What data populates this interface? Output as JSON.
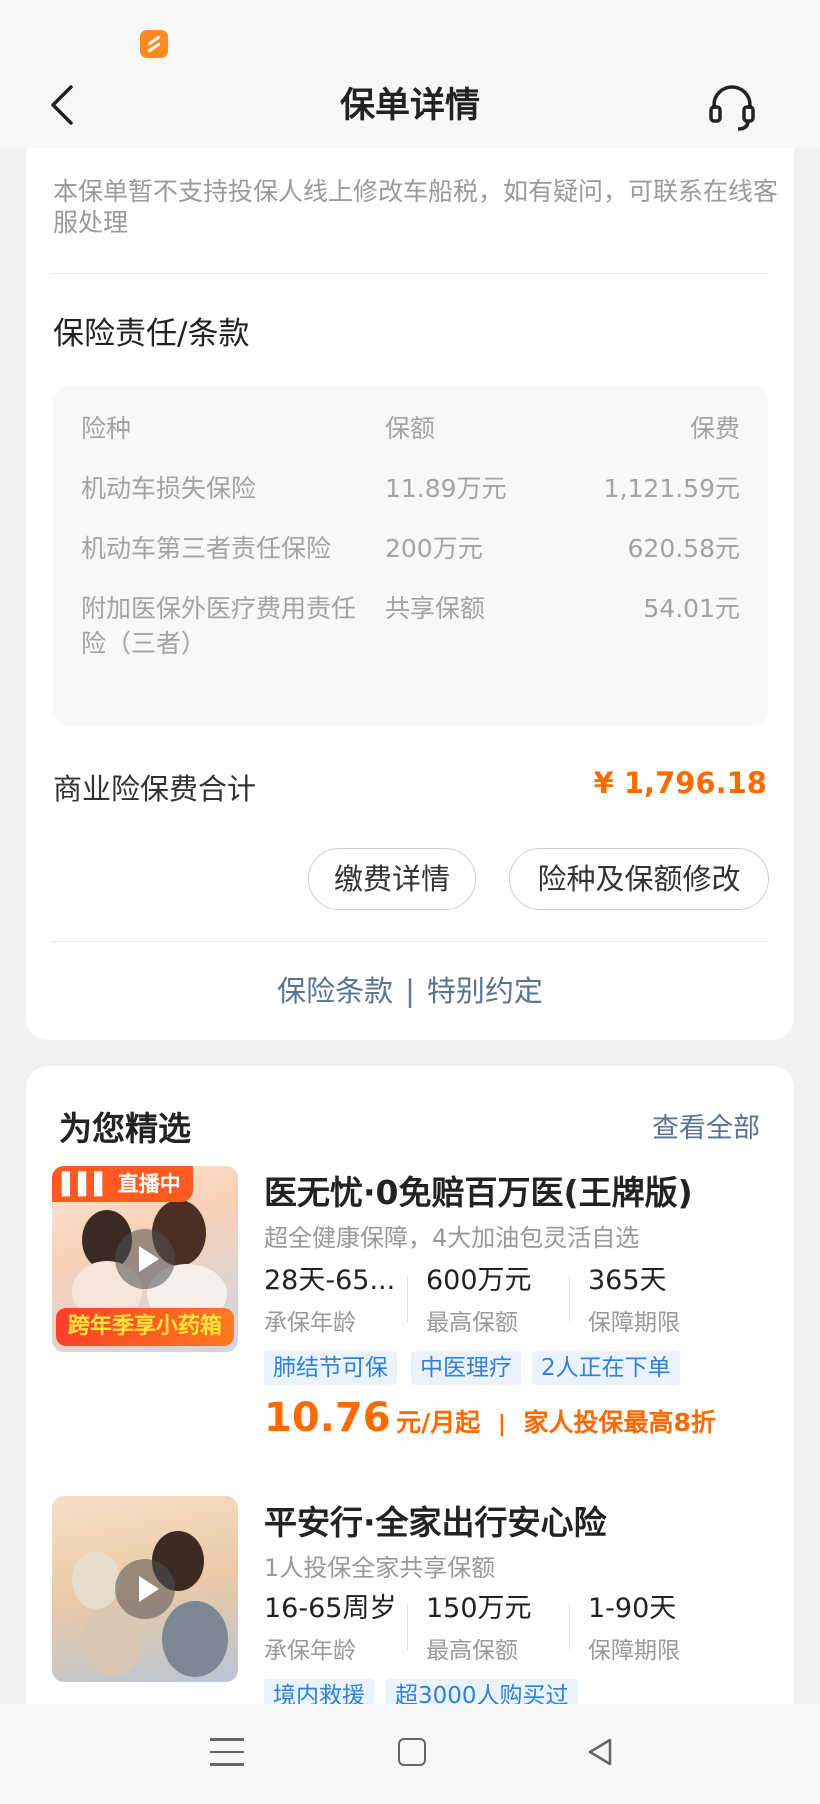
{
  "nav": {
    "title": "保单详情"
  },
  "policy": {
    "notice": "本保单暂不支持投保人线上修改车船税，如有疑问，可联系在线客服处理",
    "section_title": "保险责任/条款",
    "table_headers": [
      "险种",
      "保额",
      "保费"
    ],
    "coverages": [
      {
        "name": "机动车损失保险",
        "amount": "11.89万元",
        "premium": "1,121.59元"
      },
      {
        "name": "机动车第三者责任保险",
        "amount": "200万元",
        "premium": "620.58元"
      },
      {
        "name": "附加医保外医疗费用责任险（三者）",
        "amount": "共享保额",
        "premium": "54.01元"
      }
    ],
    "total_label": "商业险保费合计",
    "total_value": "¥ 1,796.18",
    "btn_pay": "缴费详情",
    "btn_edit": "险种及保额修改",
    "link_terms": "保险条款",
    "link_sep": "|",
    "link_special": "特别约定"
  },
  "recommend": {
    "title": "为您精选",
    "view_all": "查看全部",
    "products": [
      {
        "badge": "直播中",
        "banner": "跨年季享小药箱",
        "name": "医无忧·0免赔百万医(王牌版)",
        "sub": "超全健康保障，4大加油包灵活自选",
        "stats": [
          {
            "value": "28天-65...",
            "label": "承保年龄"
          },
          {
            "value": "600万元",
            "label": "最高保额"
          },
          {
            "value": "365天",
            "label": "保障期限"
          }
        ],
        "tags": [
          "肺结节可保",
          "中医理疗",
          "2人正在下单"
        ],
        "price": "10.76",
        "price_unit": "元/月起",
        "price_sep": "|",
        "promo": "家人投保最高8折"
      },
      {
        "name": "平安行·全家出行安心险",
        "sub": "1人投保全家共享保额",
        "stats": [
          {
            "value": "16-65周岁",
            "label": "承保年龄"
          },
          {
            "value": "150万元",
            "label": "最高保额"
          },
          {
            "value": "1-90天",
            "label": "保障期限"
          }
        ],
        "tags": [
          "境内救援",
          "超3000人购买过"
        ]
      }
    ]
  },
  "colors": {
    "accent_orange": "#ff6a00",
    "link_blue": "#5a7294",
    "tag_blue": "#2f82d6",
    "live_red": "#ff5a1f"
  }
}
